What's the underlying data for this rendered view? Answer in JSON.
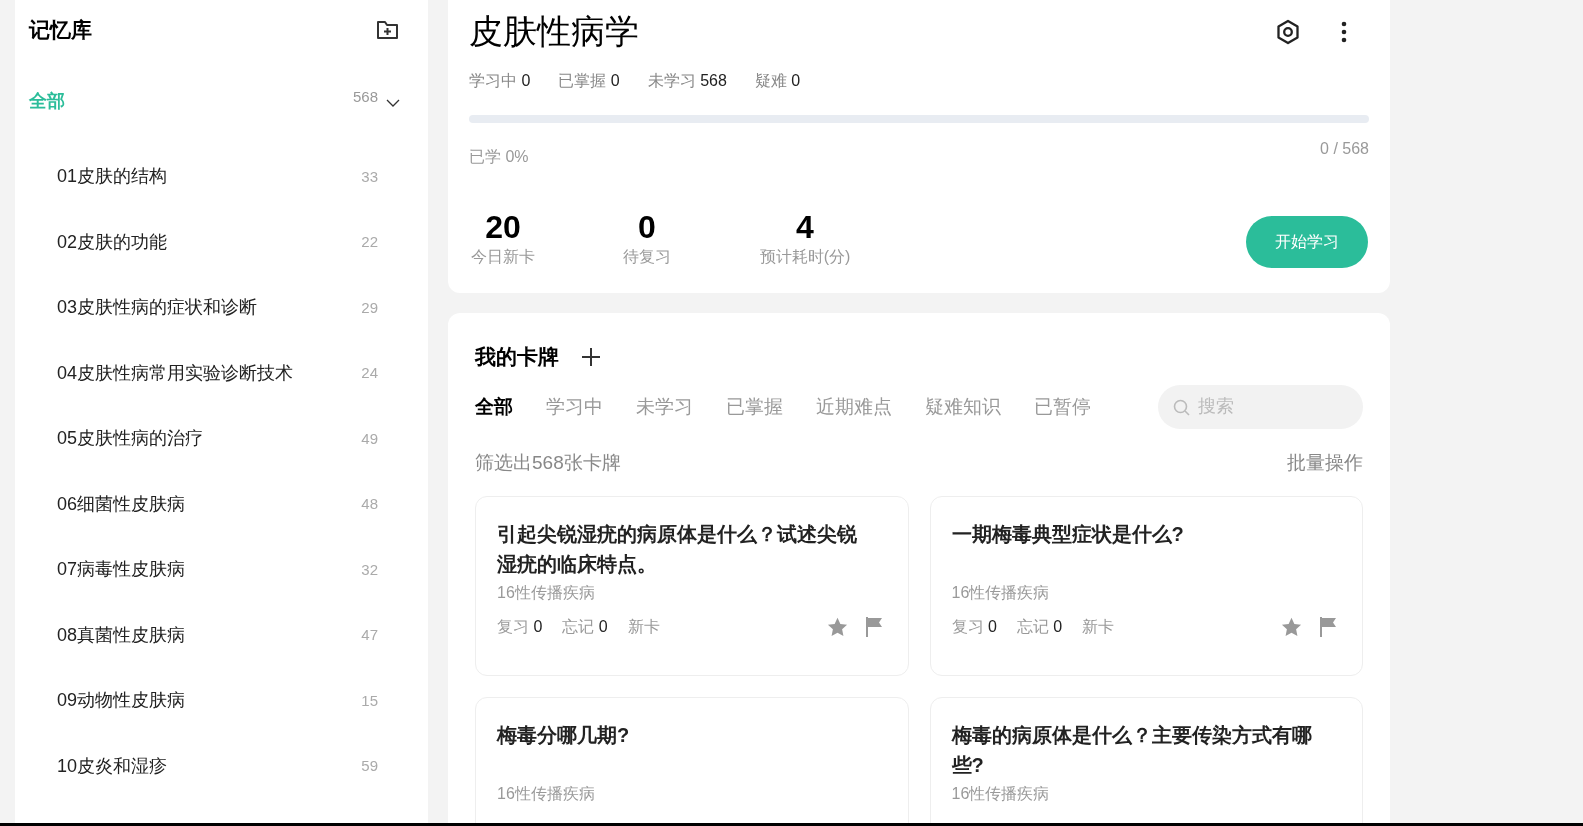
{
  "sidebar": {
    "title": "记忆库",
    "all": {
      "label": "全部",
      "count": "568",
      "selected": true,
      "expanded": true
    },
    "items": [
      {
        "label": "01皮肤的结构",
        "count": "33"
      },
      {
        "label": "02皮肤的功能",
        "count": "22"
      },
      {
        "label": "03皮肤性病的症状和诊断",
        "count": "29"
      },
      {
        "label": "04皮肤性病常用实验诊断技术",
        "count": "24"
      },
      {
        "label": "05皮肤性病的治疗",
        "count": "49"
      },
      {
        "label": "06细菌性皮肤病",
        "count": "48"
      },
      {
        "label": "07病毒性皮肤病",
        "count": "32"
      },
      {
        "label": "08真菌性皮肤病",
        "count": "47"
      },
      {
        "label": "09动物性皮肤病",
        "count": "15"
      },
      {
        "label": "10皮炎和湿疹",
        "count": "59"
      }
    ]
  },
  "deck": {
    "title": "皮肤性病学",
    "stats": [
      {
        "label": "学习中",
        "value": "0"
      },
      {
        "label": "已掌握",
        "value": "0"
      },
      {
        "label": "未学习",
        "value": "568"
      },
      {
        "label": "疑难",
        "value": "0"
      }
    ],
    "progress": {
      "level": 0,
      "label": "已学 0%",
      "count": "0 / 568"
    },
    "today": [
      {
        "value": "20",
        "label": "今日新卡"
      },
      {
        "value": "0",
        "label": "待复习"
      },
      {
        "value": "4",
        "label": "预计耗时(分)"
      }
    ],
    "start_button": "开始学习"
  },
  "cards_panel": {
    "title": "我的卡牌",
    "tabs": [
      {
        "label": "全部",
        "selected": true
      },
      {
        "label": "学习中",
        "selected": false
      },
      {
        "label": "未学习",
        "selected": false
      },
      {
        "label": "已掌握",
        "selected": false
      },
      {
        "label": "近期难点",
        "selected": false
      },
      {
        "label": "疑难知识",
        "selected": false
      },
      {
        "label": "已暂停",
        "selected": false
      }
    ],
    "search": {
      "placeholder": "搜索"
    },
    "filter_summary": "筛选出568张卡牌",
    "batch_action": "批量操作",
    "cards": [
      {
        "question": "引起尖锐湿疣的病原体是什么？试述尖锐湿疣的临床特点。",
        "category": "16性传播疾病",
        "review_label": "复习",
        "review": "0",
        "forget_label": "忘记",
        "forget": "0",
        "status": "新卡"
      },
      {
        "question": "一期梅毒典型症状是什么?",
        "category": "16性传播疾病",
        "review_label": "复习",
        "review": "0",
        "forget_label": "忘记",
        "forget": "0",
        "status": "新卡"
      },
      {
        "question": "梅毒分哪几期?",
        "category": "16性传播疾病"
      },
      {
        "question": "梅毒的病原体是什么？主要传染方式有哪些?",
        "category": "16性传播疾病"
      }
    ]
  }
}
